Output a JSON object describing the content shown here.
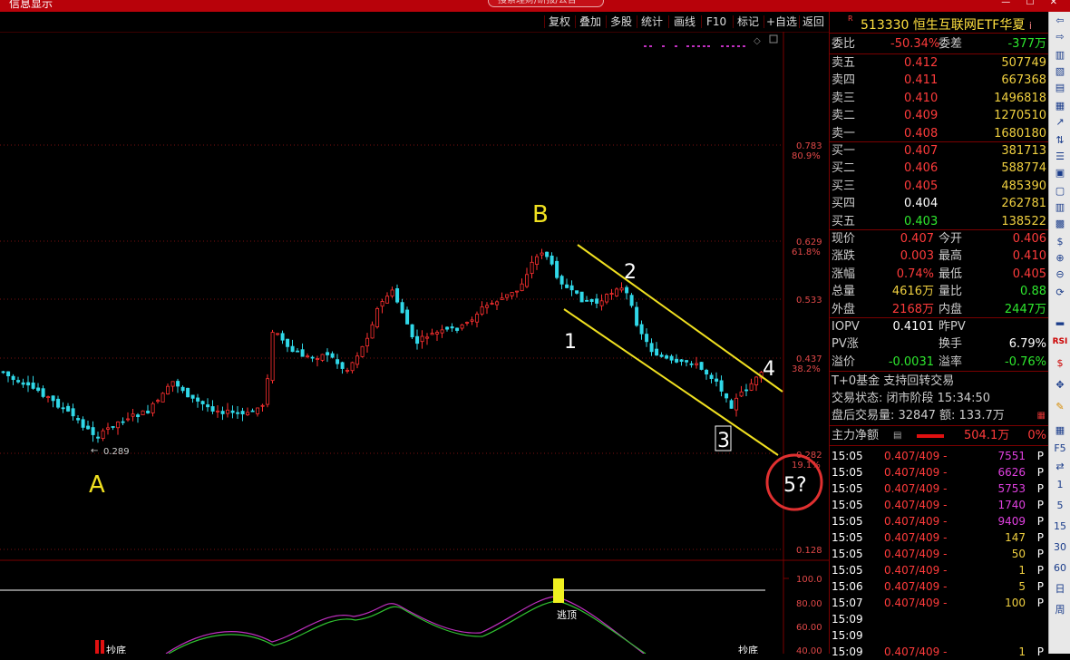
{
  "app": {
    "title": "信息显示",
    "search_placeholder": "搜索理财/研报/公告"
  },
  "toolbar": {
    "items": [
      "复权",
      "叠加",
      "多股",
      "统计",
      "画线",
      "F10",
      "标记",
      "+自选",
      "返回"
    ]
  },
  "stock": {
    "flag": "R",
    "code": "513330",
    "name": "恒生互联网ETF华夏",
    "info": "i"
  },
  "weibi": {
    "label": "委比",
    "value": "-50.34%",
    "label2": "委差",
    "value2": "-377万"
  },
  "sell": [
    {
      "label": "卖五",
      "price": "0.412",
      "vol": "507749"
    },
    {
      "label": "卖四",
      "price": "0.411",
      "vol": "667368"
    },
    {
      "label": "卖三",
      "price": "0.410",
      "vol": "1496818"
    },
    {
      "label": "卖二",
      "price": "0.409",
      "vol": "1270510"
    },
    {
      "label": "卖一",
      "price": "0.408",
      "vol": "1680180"
    }
  ],
  "buy": [
    {
      "label": "买一",
      "price": "0.407",
      "vol": "381713"
    },
    {
      "label": "买二",
      "price": "0.406",
      "vol": "588774"
    },
    {
      "label": "买三",
      "price": "0.405",
      "vol": "485390"
    },
    {
      "label": "买四",
      "price": "0.404",
      "vol": "262781"
    },
    {
      "label": "买五",
      "price": "0.403",
      "vol": "138522"
    }
  ],
  "quote": [
    {
      "l1": "现价",
      "v1": "0.407",
      "l2": "今开",
      "v2": "0.406"
    },
    {
      "l1": "涨跌",
      "v1": "0.003",
      "l2": "最高",
      "v2": "0.410"
    },
    {
      "l1": "涨幅",
      "v1": "0.74%",
      "l2": "最低",
      "v2": "0.405"
    },
    {
      "l1": "总量",
      "v1": "4616万",
      "l2": "量比",
      "v2": "0.88"
    },
    {
      "l1": "外盘",
      "v1": "2168万",
      "l2": "内盘",
      "v2": "2447万"
    }
  ],
  "iopv": [
    {
      "l1": "IOPV",
      "v1": "0.4101",
      "l2": "昨PV",
      "v2": ""
    },
    {
      "l1": "PV涨",
      "v1": "",
      "l2": "换手",
      "v2": "6.79%"
    },
    {
      "l1": "溢价",
      "v1": "-0.0031",
      "l2": "溢率",
      "v2": "-0.76%"
    }
  ],
  "fund_info": {
    "t0": "T+0基金 支持回转交易",
    "status": "交易状态: 闭市阶段 15:34:50",
    "after_hours": "盘后交易量: 32847 额: 133.7万"
  },
  "main_flow": {
    "label": "主力净额",
    "value": "504.1万",
    "pct": "0%"
  },
  "ticks": [
    {
      "time": "15:05",
      "price": "0.407/409 -",
      "vol": "7551",
      "flag": "P"
    },
    {
      "time": "15:05",
      "price": "0.407/409 -",
      "vol": "6626",
      "flag": "P"
    },
    {
      "time": "15:05",
      "price": "0.407/409 -",
      "vol": "5753",
      "flag": "P"
    },
    {
      "time": "15:05",
      "price": "0.407/409 -",
      "vol": "1740",
      "flag": "P"
    },
    {
      "time": "15:05",
      "price": "0.407/409 -",
      "vol": "9409",
      "flag": "P"
    },
    {
      "time": "15:05",
      "price": "0.407/409 -",
      "vol": "147",
      "flag": "P"
    },
    {
      "time": "15:05",
      "price": "0.407/409 -",
      "vol": "50",
      "flag": "P"
    },
    {
      "time": "15:05",
      "price": "0.407/409 -",
      "vol": "1",
      "flag": "P"
    },
    {
      "time": "15:06",
      "price": "0.407/409 -",
      "vol": "5",
      "flag": "P"
    },
    {
      "time": "15:07",
      "price": "0.407/409 -",
      "vol": "100",
      "flag": "P"
    },
    {
      "time": "15:09",
      "price": "",
      "vol": "",
      "flag": ""
    },
    {
      "time": "15:09",
      "price": "",
      "vol": "",
      "flag": ""
    },
    {
      "time": "15:09",
      "price": "0.407/409 -",
      "vol": "1",
      "flag": "P"
    }
  ],
  "price_axis": [
    {
      "price": "0.783",
      "pct": "80.9%"
    },
    {
      "price": "0.629",
      "pct": "61.8%"
    },
    {
      "price": "0.533",
      "pct": ""
    },
    {
      "price": "0.437",
      "pct": "38.2%"
    },
    {
      "price": "0.282",
      "pct": "19.1%"
    },
    {
      "price": "0.128",
      "pct": ""
    }
  ],
  "indicator_axis": [
    "100.0",
    "80.00",
    "60.00",
    "40.00"
  ],
  "annotations": {
    "low_price": "0.289",
    "wave_a": "A",
    "wave_b": "B",
    "wave_1": "1",
    "wave_2": "2",
    "wave_3": "3",
    "wave_4": "4",
    "wave_5": "5?",
    "escape_top": "逃顶",
    "bottom_left": "抄底",
    "bottom_right": "抄底"
  },
  "right_tools": [
    "1",
    "5",
    "15",
    "30",
    "60",
    "日",
    "周"
  ]
}
